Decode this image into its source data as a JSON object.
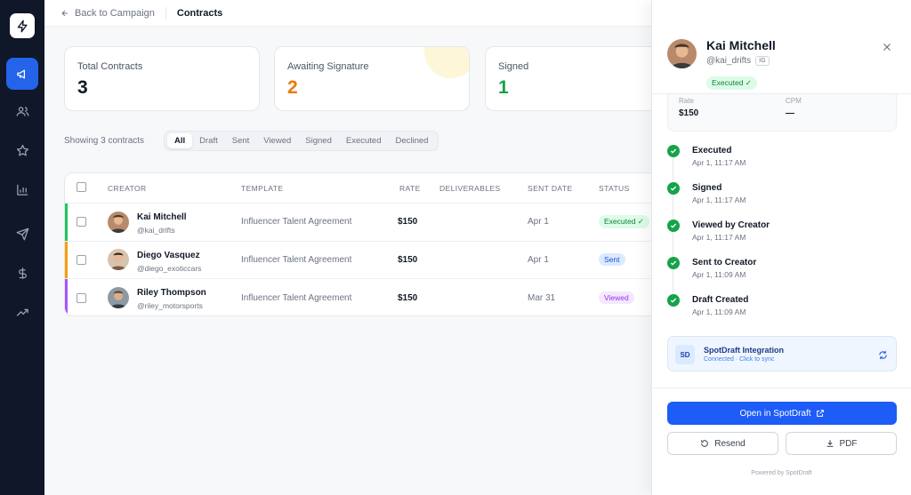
{
  "topbar": {
    "back_label": "Back to Campaign",
    "title": "Contracts"
  },
  "stats": [
    {
      "label": "Total Contracts",
      "value": "3",
      "color": "#111827"
    },
    {
      "label": "Awaiting Signature",
      "value": "2",
      "color": "#ea7a0b"
    },
    {
      "label": "Signed",
      "value": "1",
      "color": "#16a34a"
    }
  ],
  "filter_bar": {
    "showing": "Showing 3 contracts",
    "tabs": [
      "All",
      "Draft",
      "Sent",
      "Viewed",
      "Signed",
      "Executed",
      "Declined"
    ],
    "active": "All"
  },
  "table": {
    "columns": [
      "CREATOR",
      "TEMPLATE",
      "RATE",
      "DELIVERABLES",
      "SENT DATE",
      "STATUS"
    ],
    "rows": [
      {
        "name": "Kai Mitchell",
        "handle": "@kai_drifts",
        "template": "Influencer Talent Agreement",
        "rate": "$150",
        "deliverables": "",
        "sent_date": "Apr 1",
        "status": "Executed ✓",
        "accent": "#22c55e"
      },
      {
        "name": "Diego Vasquez",
        "handle": "@diego_exoticcars",
        "template": "Influencer Talent Agreement",
        "rate": "$150",
        "deliverables": "",
        "sent_date": "Apr 1",
        "status": "Sent",
        "accent": "#f59e0b"
      },
      {
        "name": "Riley Thompson",
        "handle": "@riley_motorsports",
        "template": "Influencer Talent Agreement",
        "rate": "$150",
        "deliverables": "",
        "sent_date": "Mar 31",
        "status": "Viewed",
        "accent": "#a855f7"
      }
    ]
  },
  "panel": {
    "name": "Kai Mitchell",
    "handle": "@kai_drifts",
    "platform": "IG",
    "status": "Executed ✓",
    "rate_label": "Rate",
    "rate_value": "$150",
    "cpm_label": "CPM",
    "cpm_value": "—",
    "timeline": [
      {
        "title": "Executed",
        "time": "Apr 1, 11:17 AM"
      },
      {
        "title": "Signed",
        "time": "Apr 1, 11:17 AM"
      },
      {
        "title": "Viewed by Creator",
        "time": "Apr 1, 11:17 AM"
      },
      {
        "title": "Sent to Creator",
        "time": "Apr 1, 11:09 AM"
      },
      {
        "title": "Draft Created",
        "time": "Apr 1, 11:09 AM"
      }
    ],
    "integration": {
      "logo": "SD",
      "title": "SpotDraft Integration",
      "subtitle": "Connected · Click to sync"
    },
    "open_button": "Open in SpotDraft",
    "resend_button": "Resend",
    "pdf_button": "PDF",
    "powered_by": "Powered by SpotDraft"
  }
}
